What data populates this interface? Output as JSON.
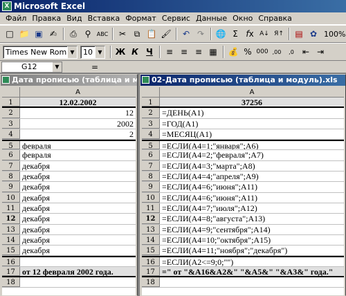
{
  "app": {
    "title": "Microsoft Excel"
  },
  "menu": [
    "Файл",
    "Правка",
    "Вид",
    "Вставка",
    "Формат",
    "Сервис",
    "Данные",
    "Окно",
    "Справка"
  ],
  "toolbar1": {
    "icons": [
      "new-icon",
      "open-icon",
      "save-icon",
      "permission-icon",
      "print-icon",
      "print-preview-icon",
      "spelling-icon",
      "cut-icon",
      "copy-icon",
      "paste-icon",
      "format-painter-icon",
      "undo-icon",
      "redo-icon",
      "hyperlink-icon",
      "autosum-icon",
      "function-icon",
      "sort-ascending-icon",
      "sort-descending-icon",
      "chart-wizard-icon",
      "drawing-icon"
    ],
    "zoom": "100%"
  },
  "toolbar2": {
    "font": "Times New Roman",
    "size": "10",
    "bold": "Ж",
    "italic": "К",
    "underline": "Ч"
  },
  "formula_bar": {
    "name_box": "G12",
    "fx": "="
  },
  "left_window": {
    "title": "Дата прописью (таблица и мо",
    "column": "A",
    "rows": [
      {
        "n": "1",
        "v": "12.02.2002",
        "align": "c",
        "bold": true
      },
      {
        "n": "2",
        "v": "12",
        "align": "r"
      },
      {
        "n": "3",
        "v": "2002",
        "align": "r"
      },
      {
        "n": "4",
        "v": "2",
        "align": "r"
      },
      {
        "n": "5",
        "v": "февраля"
      },
      {
        "n": "6",
        "v": "февраля"
      },
      {
        "n": "7",
        "v": "декабря"
      },
      {
        "n": "8",
        "v": "декабря"
      },
      {
        "n": "9",
        "v": "декабря"
      },
      {
        "n": "10",
        "v": "декабря"
      },
      {
        "n": "11",
        "v": "декабря"
      },
      {
        "n": "12",
        "v": "декабря"
      },
      {
        "n": "13",
        "v": "декабря"
      },
      {
        "n": "14",
        "v": "декабря"
      },
      {
        "n": "15",
        "v": "декабря"
      },
      {
        "n": "16",
        "v": ""
      },
      {
        "n": "17",
        "v": "от  12  февраля  2002 года.",
        "bold": true
      },
      {
        "n": "18",
        "v": ""
      }
    ]
  },
  "right_window": {
    "title": "02-Дата прописью (таблица и модуль).xls",
    "column": "A",
    "rows": [
      {
        "n": "1",
        "v": "37256",
        "align": "c",
        "bold": true
      },
      {
        "n": "2",
        "v": "=ДЕНЬ(A1)"
      },
      {
        "n": "3",
        "v": "=ГОД(A1)"
      },
      {
        "n": "4",
        "v": "=МЕСЯЦ(A1)"
      },
      {
        "n": "5",
        "v": "=ЕСЛИ(A4=1;\"января\";A6)"
      },
      {
        "n": "6",
        "v": "=ЕСЛИ(A4=2;\"февраля\";A7)"
      },
      {
        "n": "7",
        "v": "=ЕСЛИ(A4=3;\"марта\";A8)"
      },
      {
        "n": "8",
        "v": "=ЕСЛИ(A4=4;\"апреля\";A9)"
      },
      {
        "n": "9",
        "v": "=ЕСЛИ(A4=6;\"июня\";A11)"
      },
      {
        "n": "10",
        "v": "=ЕСЛИ(A4=6;\"июня\";A11)"
      },
      {
        "n": "11",
        "v": "=ЕСЛИ(A4=7;\"июля\";A12)"
      },
      {
        "n": "12",
        "v": "=ЕСЛИ(A4=8;\"августа\";A13)"
      },
      {
        "n": "13",
        "v": "=ЕСЛИ(A4=9;\"сентября\";A14)"
      },
      {
        "n": "14",
        "v": "=ЕСЛИ(A4=10;\"октября\";A15)"
      },
      {
        "n": "15",
        "v": "=ЕСЛИ(A4=11;\"ноября\";\"декабря\")"
      },
      {
        "n": "16",
        "v": "=ЕСЛИ(A2<=9;0;\"\")"
      },
      {
        "n": "17",
        "v": "=\"  от  \"&A16&A2&\"  \"&A5&\"  \"&A3&\" года.\"",
        "bold": true
      },
      {
        "n": "18",
        "v": ""
      }
    ]
  },
  "selected_row": "12"
}
